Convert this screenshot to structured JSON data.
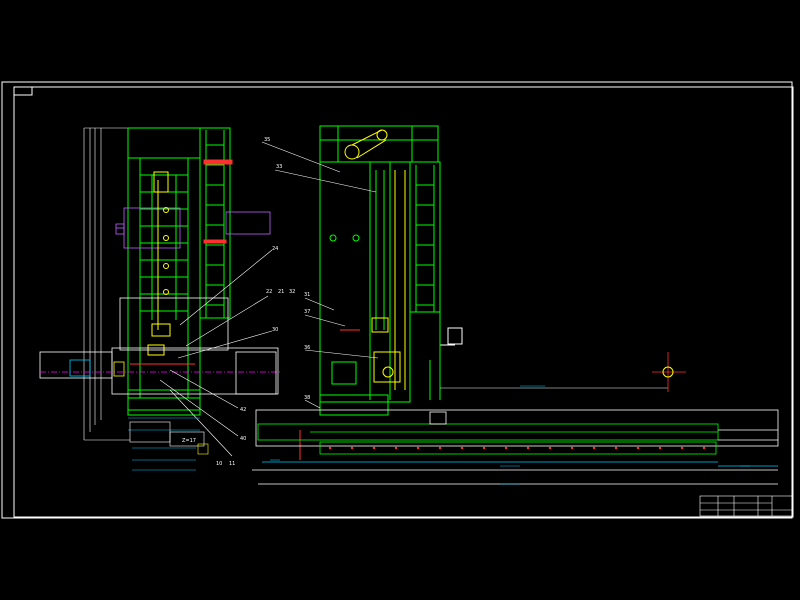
{
  "colors": {
    "background": "#000000",
    "frame": "#ffffff",
    "structure": "#00ff00",
    "part": "#ffff00",
    "dimension": "#00c8ff",
    "centerline": "#ff00ff",
    "accent": "#ff3030",
    "label": "#ffffff"
  },
  "part_labels": [
    {
      "id": "lbl-24",
      "text": "24"
    },
    {
      "id": "lbl-22",
      "text": "22"
    },
    {
      "id": "lbl-21",
      "text": "21"
    },
    {
      "id": "lbl-32",
      "text": "32"
    },
    {
      "id": "lbl-30",
      "text": "30"
    },
    {
      "id": "lbl-42",
      "text": "42"
    },
    {
      "id": "lbl-40",
      "text": "40"
    },
    {
      "id": "lbl-10",
      "text": "10"
    },
    {
      "id": "lbl-11",
      "text": "11"
    },
    {
      "id": "lbl-z",
      "text": "Z=17"
    },
    {
      "id": "lbl-35",
      "text": "35"
    },
    {
      "id": "lbl-33",
      "text": "33"
    },
    {
      "id": "lbl-31",
      "text": "31"
    },
    {
      "id": "lbl-37",
      "text": "37"
    },
    {
      "id": "lbl-36",
      "text": "36"
    },
    {
      "id": "lbl-38",
      "text": "38"
    }
  ],
  "title_block": {
    "cells": [
      "",
      "",
      "",
      "",
      "",
      ""
    ]
  }
}
